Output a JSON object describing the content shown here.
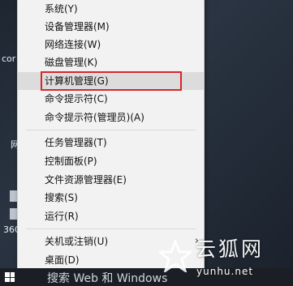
{
  "desktop": {
    "left_texts": [
      "cor",
      "网",
      "360"
    ]
  },
  "context_menu": {
    "items": [
      {
        "label": "系统(Y)"
      },
      {
        "label": "设备管理器(M)"
      },
      {
        "label": "网络连接(W)"
      },
      {
        "label": "磁盘管理(K)"
      },
      {
        "label": "计算机管理(G)",
        "highlighted": true
      },
      {
        "label": "命令提示符(C)"
      },
      {
        "label": "命令提示符(管理员)(A)"
      },
      {
        "label": "任务管理器(T)"
      },
      {
        "label": "控制面板(P)"
      },
      {
        "label": "文件资源管理器(E)"
      },
      {
        "label": "搜索(S)"
      },
      {
        "label": "运行(R)"
      },
      {
        "label": "关机或注销(U)",
        "submenu": true
      },
      {
        "label": "桌面(D)"
      }
    ],
    "highlight_color": "#d9252a",
    "submenu_icon": "chevron-right-icon"
  },
  "taskbar": {
    "search_text": "搜索 Web 和 Windows",
    "start_icon": "windows-logo-icon"
  },
  "watermark": {
    "text": "云狐网",
    "url": "yunhu.net",
    "logo": "star-logo-icon"
  }
}
